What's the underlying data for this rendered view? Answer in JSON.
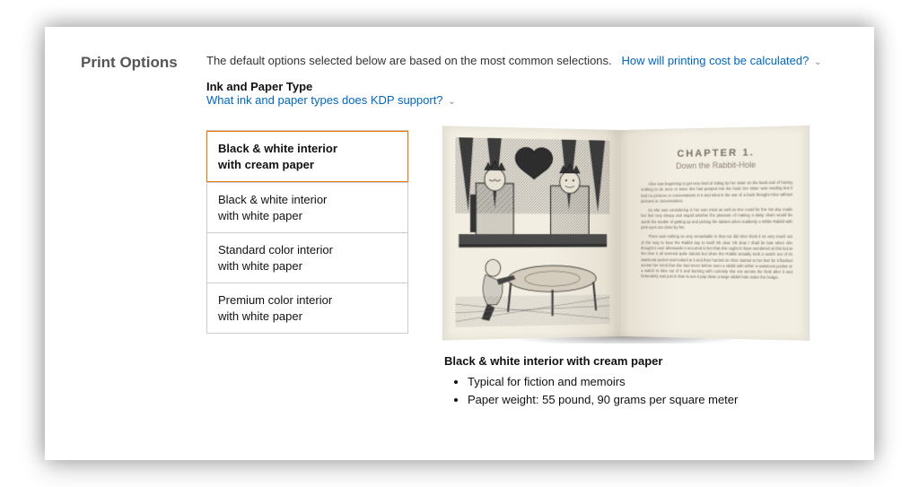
{
  "section": {
    "title": "Print Options",
    "intro_text": "The default options selected below are based on the most common selections.",
    "cost_link": "How will printing cost be calculated?"
  },
  "ink_paper": {
    "heading": "Ink and Paper Type",
    "support_link": "What ink and paper types does KDP support?"
  },
  "options": [
    {
      "line1": "Black & white interior",
      "line2": "with cream paper"
    },
    {
      "line1": "Black & white interior",
      "line2": "with white paper"
    },
    {
      "line1": "Standard color interior",
      "line2": "with white paper"
    },
    {
      "line1": "Premium color interior",
      "line2": "with white paper"
    }
  ],
  "preview": {
    "chapter_label": "CHAPTER 1.",
    "chapter_title": "Down the Rabbit-Hole"
  },
  "details": {
    "heading": "Black & white interior with cream paper",
    "bullets": [
      "Typical for fiction and memoirs",
      "Paper weight: 55 pound, 90 grams per square meter"
    ]
  }
}
